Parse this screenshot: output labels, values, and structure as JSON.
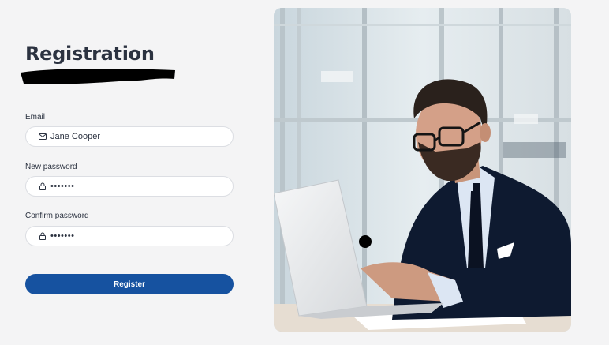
{
  "form": {
    "title": "Registration",
    "email": {
      "label": "Email",
      "value": "Jane Cooper",
      "icon": "mail-icon"
    },
    "new_password": {
      "label": "New password",
      "value": "•••••••",
      "icon": "lock-icon"
    },
    "confirm_password": {
      "label": "Confirm password",
      "value": "•••••••",
      "icon": "lock-icon"
    },
    "submit_label": "Register"
  },
  "colors": {
    "accent": "#1652a0",
    "background": "#f4f4f5",
    "field_border": "#dcdee3"
  }
}
